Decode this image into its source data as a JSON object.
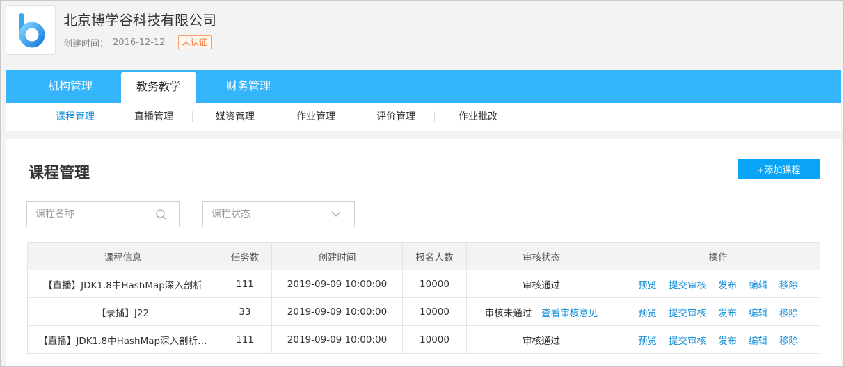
{
  "company": {
    "name": "北京博学谷科技有限公司",
    "created_label": "创建时间：",
    "created_date": "2016-12-12",
    "badge": "未认证"
  },
  "colors": {
    "primary": "#34b4fb",
    "button": "#0aa4f6",
    "link": "#1890d8",
    "badge": "#f56c2a"
  },
  "main_nav": [
    {
      "label": "机构管理",
      "active": false
    },
    {
      "label": "教务教学",
      "active": true
    },
    {
      "label": "财务管理",
      "active": false
    }
  ],
  "sub_nav": [
    {
      "label": "课程管理",
      "active": true
    },
    {
      "label": "直播管理",
      "active": false
    },
    {
      "label": "媒资管理",
      "active": false
    },
    {
      "label": "作业管理",
      "active": false
    },
    {
      "label": "评价管理",
      "active": false
    },
    {
      "label": "作业批改",
      "active": false
    }
  ],
  "page": {
    "title": "课程管理",
    "add_button": "+添加课程"
  },
  "filters": {
    "name_placeholder": "课程名称",
    "status_placeholder": "课程状态"
  },
  "table": {
    "headers": [
      "课程信息",
      "任务数",
      "创建时间",
      "报名人数",
      "审核状态",
      "操作"
    ],
    "actions": [
      "预览",
      "提交审核",
      "发布",
      "编辑",
      "移除"
    ],
    "rows": [
      {
        "info": "【直播】JDK1.8中HashMap深入剖析",
        "tasks": "111",
        "created": "2019-09-09 10:00:00",
        "enrolled": "10000",
        "status": "审核通过",
        "status_link": ""
      },
      {
        "info": "【录播】J22",
        "tasks": "33",
        "created": "2019-09-09 10:00:00",
        "enrolled": "10000",
        "status": "审核未通过",
        "status_link": "查看审核意见"
      },
      {
        "info": "【直播】JDK1.8中HashMap深入剖析…",
        "tasks": "111",
        "created": "2019-09-09 10:00:00",
        "enrolled": "10000",
        "status": "审核通过",
        "status_link": ""
      }
    ]
  }
}
